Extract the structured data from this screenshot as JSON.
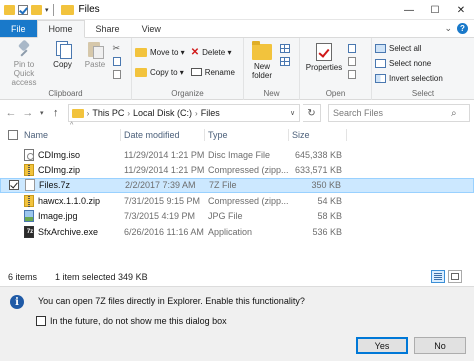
{
  "window": {
    "title": "Files"
  },
  "titlebar": {
    "dropdown_glyph": "▾",
    "minimize": "—",
    "maximize": "☐",
    "close": "✕"
  },
  "ribbon_tabs": [
    {
      "label": "File"
    },
    {
      "label": "Home"
    },
    {
      "label": "Share"
    },
    {
      "label": "View"
    }
  ],
  "ribbon_right": {
    "expand_glyph": "⌄",
    "help_glyph": "?"
  },
  "ribbon": {
    "clipboard": {
      "label": "Clipboard",
      "pin_label": "Pin to Quick access",
      "copy_label": "Copy",
      "paste_label": "Paste"
    },
    "organize": {
      "label": "Organize",
      "move_to": "Move to ▾",
      "copy_to": "Copy to ▾",
      "delete": "Delete ▾",
      "rename": "Rename"
    },
    "new": {
      "label": "New",
      "new_folder": "New folder"
    },
    "open": {
      "label": "Open",
      "properties": "Properties"
    },
    "select": {
      "label": "Select",
      "select_all": "Select all",
      "select_none": "Select none",
      "invert_selection": "Invert selection"
    }
  },
  "nav": {
    "back_glyph": "←",
    "forward_glyph": "→",
    "recent_glyph": "▾",
    "up_glyph": "↑",
    "address_parts": [
      "This PC",
      "Local Disk (C:)",
      "Files"
    ],
    "address_sep": "›",
    "address_drop_glyph": "∨",
    "refresh_glyph": "↻",
    "search_placeholder": "Search Files",
    "search_glyph": "⌕"
  },
  "columns": {
    "name": "Name",
    "date": "Date modified",
    "type": "Type",
    "size": "Size",
    "sort_glyph": "^"
  },
  "files": [
    {
      "name": "CDImg.iso",
      "date": "11/29/2014 1:21 PM",
      "type": "Disc Image File",
      "size": "645,338 KB",
      "icon": "disc-image-icon"
    },
    {
      "name": "CDImg.zip",
      "date": "11/29/2014 1:21 PM",
      "type": "Compressed (zipp...",
      "size": "633,571 KB",
      "icon": "zip-folder-icon"
    },
    {
      "name": "Files.7z",
      "date": "2/2/2017 7:39 AM",
      "type": "7Z File",
      "size": "350 KB",
      "icon": "7z-file-icon",
      "selected": true
    },
    {
      "name": "hawcx.1.1.0.zip",
      "date": "7/31/2015 9:15 PM",
      "type": "Compressed (zipp...",
      "size": "54 KB",
      "icon": "zip-folder-icon"
    },
    {
      "name": "Image.jpg",
      "date": "7/3/2015 4:19 PM",
      "type": "JPG File",
      "size": "58 KB",
      "icon": "image-file-icon"
    },
    {
      "name": "SfxArchive.exe",
      "date": "6/26/2016 11:16 AM",
      "type": "Application",
      "size": "536 KB",
      "icon": "7z-sfx-exe-icon"
    }
  ],
  "status": {
    "items": "6 items",
    "selected": "1 item selected  349 KB"
  },
  "infobar": {
    "icon_glyph": "i",
    "message": "You can open 7Z files directly in Explorer. Enable this functionality?",
    "dont_show": "In the future, do not show me this dialog box",
    "yes": "Yes",
    "no": "No"
  }
}
